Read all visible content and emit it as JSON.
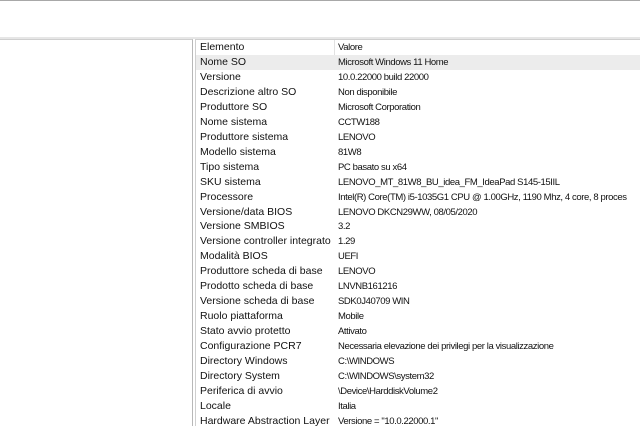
{
  "table": {
    "headers": [
      "Elemento",
      "Valore"
    ],
    "rows": [
      [
        "Nome SO",
        "Microsoft Windows 11 Home"
      ],
      [
        "Versione",
        "10.0.22000 build 22000"
      ],
      [
        "Descrizione altro SO",
        "Non disponibile"
      ],
      [
        "Produttore SO",
        "Microsoft Corporation"
      ],
      [
        "Nome sistema",
        "CCTW188"
      ],
      [
        "Produttore sistema",
        "LENOVO"
      ],
      [
        "Modello sistema",
        "81W8"
      ],
      [
        "Tipo sistema",
        "PC basato su x64"
      ],
      [
        "SKU sistema",
        "LENOVO_MT_81W8_BU_idea_FM_IdeaPad S145-15IIL"
      ],
      [
        "Processore",
        "Intel(R) Core(TM) i5-1035G1 CPU @ 1.00GHz, 1190 Mhz, 4 core, 8 proces"
      ],
      [
        "Versione/data BIOS",
        "LENOVO DKCN29WW, 08/05/2020"
      ],
      [
        "Versione SMBIOS",
        "3.2"
      ],
      [
        "Versione controller integrato",
        "1.29"
      ],
      [
        "Modalità BIOS",
        "UEFI"
      ],
      [
        "Produttore scheda di base",
        "LENOVO"
      ],
      [
        "Prodotto scheda di base",
        "LNVNB161216"
      ],
      [
        "Versione scheda di base",
        "SDK0J40709 WIN"
      ],
      [
        "Ruolo piattaforma",
        "Mobile"
      ],
      [
        "Stato avvio protetto",
        "Attivato"
      ],
      [
        "Configurazione PCR7",
        "Necessaria elevazione dei privilegi per la visualizzazione"
      ],
      [
        "Directory Windows",
        "C:\\WINDOWS"
      ],
      [
        "Directory System",
        "C:\\WINDOWS\\system32"
      ],
      [
        "Periferica di avvio",
        "\\Device\\HarddiskVolume2"
      ],
      [
        "Locale",
        "Italia"
      ],
      [
        "Hardware Abstraction Layer",
        "Versione = \"10.0.22000.1\""
      ]
    ],
    "selected_row": 0
  }
}
